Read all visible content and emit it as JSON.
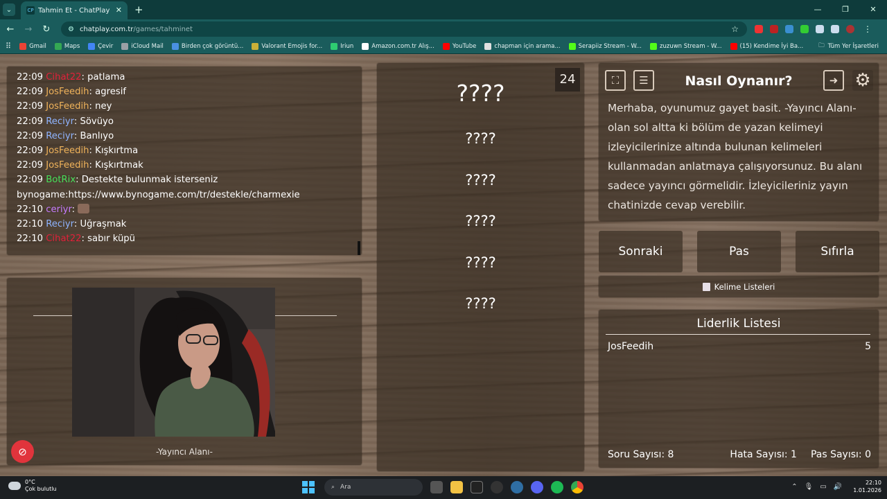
{
  "browser": {
    "tab_title": "Tahmin Et - ChatPlay",
    "tab_favicon": "CP",
    "url_domain": "chatplay.com.tr",
    "url_path": "/games/tahminet",
    "bookmarks": [
      {
        "label": "Gmail",
        "icon": "gmail-icon",
        "color": "#ea4335"
      },
      {
        "label": "Maps",
        "icon": "maps-icon",
        "color": "#34a853"
      },
      {
        "label": "Çevir",
        "icon": "translate-icon",
        "color": "#4285f4"
      },
      {
        "label": "iCloud Mail",
        "icon": "apple-icon",
        "color": "#9aa0a6"
      },
      {
        "label": "Birden çok görüntü...",
        "icon": "diamond-icon",
        "color": "#4a90e2"
      },
      {
        "label": "Valorant Emojis for...",
        "icon": "valorant-icon",
        "color": "#c9b037"
      },
      {
        "label": "Iriun",
        "icon": "iriun-icon",
        "color": "#2ecc71"
      },
      {
        "label": "Amazon.com.tr Alış...",
        "icon": "amazon-icon",
        "color": "#ffffff"
      },
      {
        "label": "YouTube",
        "icon": "youtube-icon",
        "color": "#ff0000"
      },
      {
        "label": "chapman için arama...",
        "icon": "search-site-icon",
        "color": "#e0e0e0"
      },
      {
        "label": "Serapiiz Stream - W...",
        "icon": "kick-icon",
        "color": "#53fc18"
      },
      {
        "label": "zuzuwn Stream - W...",
        "icon": "kick-icon",
        "color": "#53fc18"
      },
      {
        "label": "(15) Kendime İyi Ba...",
        "icon": "youtube-icon",
        "color": "#ff0000"
      }
    ],
    "all_bookmarks": "Tüm Yer İşaretleri"
  },
  "chat": {
    "messages": [
      {
        "time": "22:09",
        "user": "Cihat22",
        "user_color": "#e0223a",
        "text": ": patlama"
      },
      {
        "time": "22:09",
        "user": "JosFeedih",
        "user_color": "#f0b35a",
        "text": ": agresif"
      },
      {
        "time": "22:09",
        "user": "JosFeedih",
        "user_color": "#f0b35a",
        "text": ": ney"
      },
      {
        "time": "22:09",
        "user": "Reciyr",
        "user_color": "#8fb4ff",
        "text": ": Sövüyo"
      },
      {
        "time": "22:09",
        "user": "Reciyr",
        "user_color": "#8fb4ff",
        "text": ": Banlıyo"
      },
      {
        "time": "22:09",
        "user": "JosFeedih",
        "user_color": "#f0b35a",
        "text": ": Kışkırtma"
      },
      {
        "time": "22:09",
        "user": "JosFeedih",
        "user_color": "#f0b35a",
        "text": ": Kışkırtmak"
      },
      {
        "time": "22:09",
        "user": "BotRix",
        "user_color": "#47e05a",
        "text": ": Destekte bulunmak isterseniz bynogame:https://www.bynogame.com/tr/destekle/charmexie"
      },
      {
        "time": "22:10",
        "user": "ceriyr",
        "user_color": "#c77dff",
        "text": ": ",
        "emote": true
      },
      {
        "time": "22:10",
        "user": "Reciyr",
        "user_color": "#8fb4ff",
        "text": ": Uğraşmak"
      },
      {
        "time": "22:10",
        "user": "Cihat22",
        "user_color": "#e0223a",
        "text": ": sabır küpü"
      }
    ]
  },
  "streamer_area": {
    "label": "-Yayıncı Alanı-"
  },
  "words": {
    "counter": "24",
    "main": "????",
    "forbidden": [
      "????",
      "????",
      "????",
      "????",
      "????"
    ]
  },
  "howto": {
    "title": "Nasıl Oynanır?",
    "body": "Merhaba, oyunumuz gayet basit. -Yayıncı Alanı- olan sol altta ki bölüm de yazan kelimeyi izleyicilerinize altında bulunan kelimeleri kullanmadan anlatmaya çalışıyorsunuz. Bu alanı sadece yayıncı görmelidir. İzleyicileriniz yayın chatinizde cevap verebilir."
  },
  "buttons": {
    "next": "Sonraki",
    "pass": "Pas",
    "reset": "Sıfırla",
    "word_lists": "Kelime Listeleri"
  },
  "leaderboard": {
    "title": "Liderlik Listesi",
    "rows": [
      {
        "name": "JosFeedih",
        "score": "5"
      }
    ],
    "question_count": "Soru Sayısı: 8",
    "error_count": "Hata Sayısı: 1",
    "pass_count": "Pas Sayısı: 0"
  },
  "taskbar": {
    "temp": "0°C",
    "weather": "Çok bulutlu",
    "search_placeholder": "Ara",
    "time": "22:10",
    "date": "1.01.2026"
  }
}
